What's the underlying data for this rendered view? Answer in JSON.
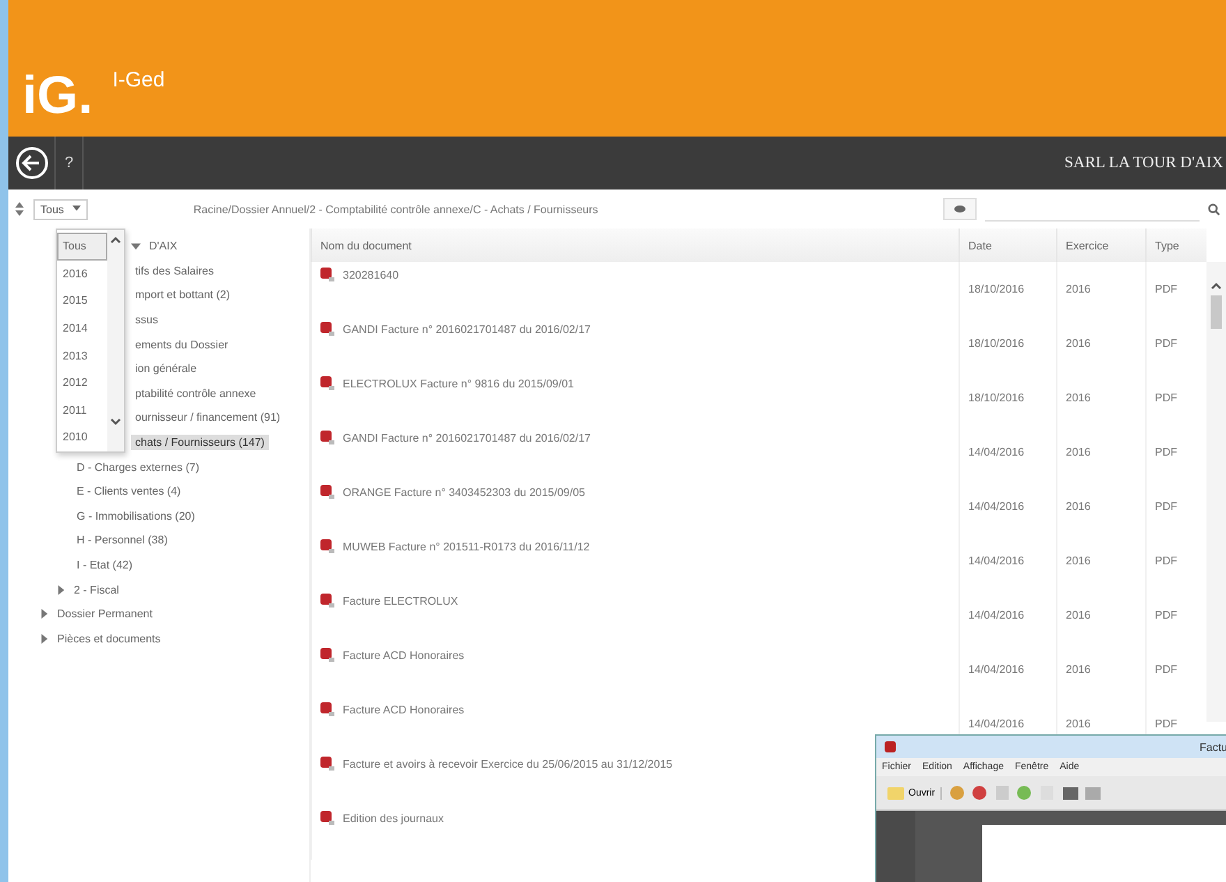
{
  "header": {
    "logo": "iG.",
    "app_name": "I-Ged"
  },
  "nav_bar": {
    "help": "?",
    "company": "SARL LA TOUR D'AIX"
  },
  "toolbar": {
    "filter": {
      "value": "Tous",
      "options": [
        {
          "label": "Tous",
          "selected": true
        },
        {
          "label": "2016",
          "selected": false
        },
        {
          "label": "2015",
          "selected": false
        },
        {
          "label": "2014",
          "selected": false
        },
        {
          "label": "2013",
          "selected": false
        },
        {
          "label": "2012",
          "selected": false
        },
        {
          "label": "2011",
          "selected": false
        },
        {
          "label": "2010",
          "selected": false
        }
      ]
    },
    "breadcrumb": "Racine/Dossier Annuel/2 - Comptabilité contrôle annexe/C - Achats / Fournisseurs"
  },
  "tree": [
    {
      "label": "D'AIX",
      "expanded": true,
      "selected": false,
      "children": [
        {
          "label": "tifs des Salaires",
          "expanded": false,
          "selected": false
        },
        {
          "label": "mport et bottant (2)",
          "expanded": false,
          "selected": false
        },
        {
          "label": "ssus",
          "expanded": true,
          "selected": false,
          "children": [
            {
              "label": "ements du Dossier",
              "selected": false
            },
            {
              "label": "ion générale",
              "selected": false
            },
            {
              "label": "ptabilité contrôle annexe",
              "expanded": true,
              "selected": false,
              "children": [
                {
                  "label": "ournisseur / financement (91)",
                  "selected": false
                },
                {
                  "label": "chats / Fournisseurs (147)",
                  "selected": true
                },
                {
                  "label": "D - Charges externes (7)",
                  "selected": false
                },
                {
                  "label": "E - Clients ventes (4)",
                  "selected": false
                },
                {
                  "label": "G - Immobilisations (20)",
                  "selected": false
                },
                {
                  "label": "H - Personnel (38)",
                  "selected": false
                },
                {
                  "label": "I - Etat (42)",
                  "selected": false
                }
              ]
            },
            {
              "label": "2 - Fiscal",
              "expanded": false,
              "selected": false
            }
          ]
        },
        {
          "label": "Dossier Permanent",
          "expanded": false,
          "selected": false
        },
        {
          "label": "Pièces et documents",
          "expanded": false,
          "selected": false
        }
      ]
    }
  ],
  "table": {
    "columns": [
      "Nom du document",
      "Date",
      "Exercice",
      "Type"
    ],
    "rows": [
      {
        "name": "320281640",
        "date": "18/10/2016",
        "exercice": "2016",
        "type": "PDF"
      },
      {
        "name": "GANDI Facture n° 2016021701487 du 2016/02/17",
        "date": "18/10/2016",
        "exercice": "2016",
        "type": "PDF"
      },
      {
        "name": "ELECTROLUX Facture n° 9816 du 2015/09/01",
        "date": "18/10/2016",
        "exercice": "2016",
        "type": "PDF"
      },
      {
        "name": "GANDI Facture n° 2016021701487 du 2016/02/17",
        "date": "14/04/2016",
        "exercice": "2016",
        "type": "PDF"
      },
      {
        "name": "ORANGE Facture n° 3403452303 du 2015/09/05",
        "date": "14/04/2016",
        "exercice": "2016",
        "type": "PDF"
      },
      {
        "name": "MUWEB Facture n° 201511-R0173 du 2016/11/12",
        "date": "14/04/2016",
        "exercice": "2016",
        "type": "PDF"
      },
      {
        "name": "Facture ELECTROLUX",
        "date": "14/04/2016",
        "exercice": "2016",
        "type": "PDF"
      },
      {
        "name": "Facture ACD Honoraires",
        "date": "14/04/2016",
        "exercice": "2016",
        "type": "PDF"
      },
      {
        "name": "Facture ACD Honoraires",
        "date": "14/04/2016",
        "exercice": "2016",
        "type": "PDF"
      },
      {
        "name": "Facture et avoirs à recevoir Exercice du 25/06/2015 au 31/12/2015"
      },
      {
        "name": "Edition des journaux"
      }
    ]
  },
  "viewer_window": {
    "title": "Factu",
    "menu": [
      "Fichier",
      "Edition",
      "Affichage",
      "Fenêtre",
      "Aide"
    ],
    "open_button": "Ouvrir"
  }
}
